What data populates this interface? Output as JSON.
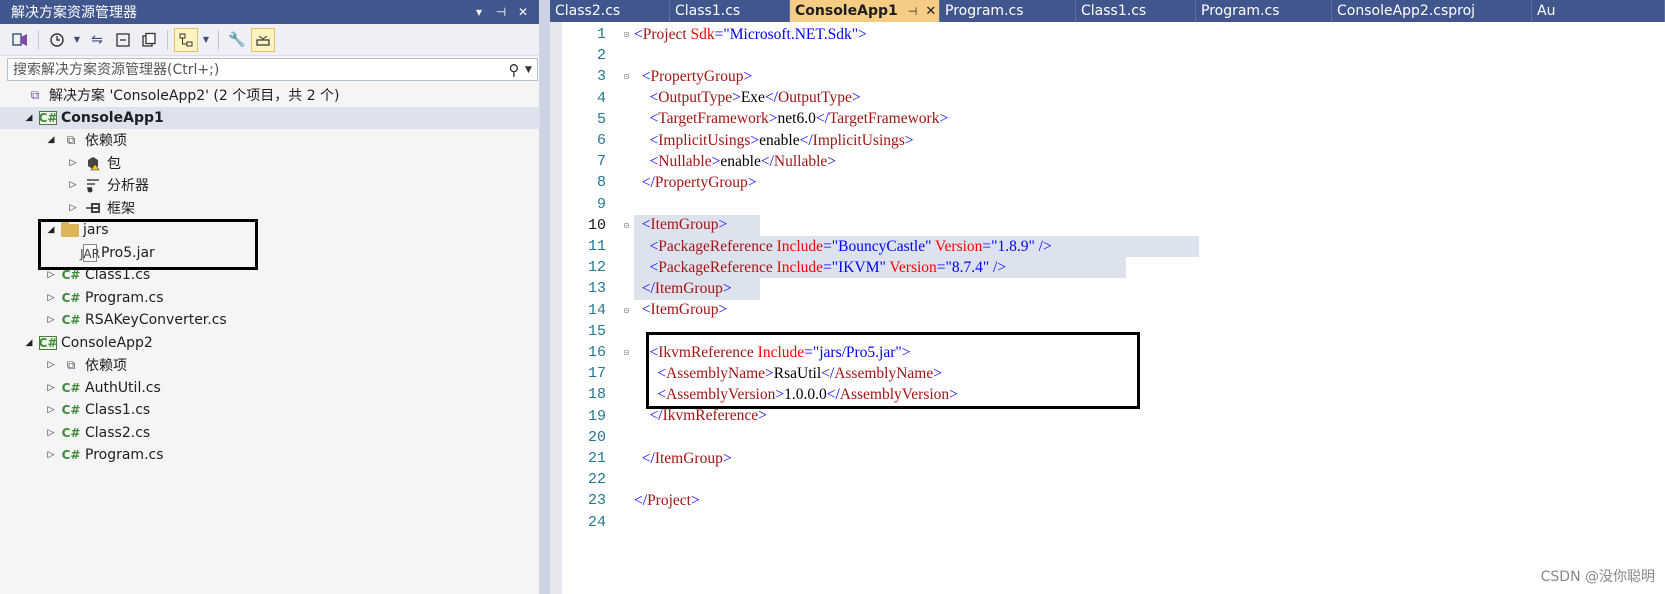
{
  "explorer": {
    "title": "解决方案资源管理器",
    "title_buttons": [
      "▾",
      "⊣",
      "✕"
    ],
    "search_placeholder": "搜索解决方案资源管理器(Ctrl+;)",
    "tree": [
      {
        "label": "解决方案 'ConsoleApp2' (2 个项目，共 2 个)",
        "icon": "solution-icon",
        "depth": 0,
        "arrow": "",
        "bold": false
      },
      {
        "label": "ConsoleApp1",
        "icon": "csharp-project-icon",
        "depth": 0,
        "arrow": "expanded",
        "bold": true,
        "selected": true
      },
      {
        "label": "依赖项",
        "icon": "dependencies-icon",
        "depth": 1,
        "arrow": "expanded",
        "bold": false
      },
      {
        "label": "包",
        "icon": "package-warning-icon",
        "depth": 2,
        "arrow": "collapsed",
        "bold": false
      },
      {
        "label": "分析器",
        "icon": "analyzer-icon",
        "depth": 2,
        "arrow": "collapsed",
        "bold": false
      },
      {
        "label": "框架",
        "icon": "framework-icon",
        "depth": 2,
        "arrow": "collapsed",
        "bold": false
      },
      {
        "label": "jars",
        "icon": "folder-icon",
        "depth": 1,
        "arrow": "expanded",
        "bold": false
      },
      {
        "label": "Pro5.jar",
        "icon": "jar-file-icon",
        "depth": 2,
        "arrow": "",
        "bold": false
      },
      {
        "label": "Class1.cs",
        "icon": "csharp-file-icon",
        "depth": 1,
        "arrow": "collapsed",
        "bold": false
      },
      {
        "label": "Program.cs",
        "icon": "csharp-file-icon",
        "depth": 1,
        "arrow": "collapsed",
        "bold": false
      },
      {
        "label": "RSAKeyConverter.cs",
        "icon": "csharp-file-icon",
        "depth": 1,
        "arrow": "collapsed",
        "bold": false
      },
      {
        "label": "ConsoleApp2",
        "icon": "csharp-project-icon",
        "depth": 0,
        "arrow": "expanded",
        "bold": false
      },
      {
        "label": "依赖项",
        "icon": "dependencies-icon",
        "depth": 1,
        "arrow": "collapsed",
        "bold": false
      },
      {
        "label": "AuthUtil.cs",
        "icon": "csharp-file-icon",
        "depth": 1,
        "arrow": "collapsed",
        "bold": false
      },
      {
        "label": "Class1.cs",
        "icon": "csharp-file-icon",
        "depth": 1,
        "arrow": "collapsed",
        "bold": false
      },
      {
        "label": "Class2.cs",
        "icon": "csharp-file-icon",
        "depth": 1,
        "arrow": "collapsed",
        "bold": false
      },
      {
        "label": "Program.cs",
        "icon": "csharp-file-icon",
        "depth": 1,
        "arrow": "collapsed",
        "bold": false
      }
    ]
  },
  "tabs": [
    {
      "label": "Class2.cs",
      "active": false
    },
    {
      "label": "Class1.cs",
      "active": false
    },
    {
      "label": "ConsoleApp1",
      "active": true
    },
    {
      "label": "Program.cs",
      "active": false
    },
    {
      "label": "Class1.cs",
      "active": false
    },
    {
      "label": "Program.cs",
      "active": false
    },
    {
      "label": "ConsoleApp2.csproj",
      "active": false
    },
    {
      "label": "Au",
      "active": false
    }
  ],
  "editor": {
    "current_line": 10,
    "lines": [
      {
        "n": "1",
        "fold": "⊟",
        "tokens": [
          [
            "br",
            "<"
          ],
          [
            "tag",
            "Project"
          ],
          [
            "plain",
            " "
          ],
          [
            "attr",
            "Sdk"
          ],
          [
            "br",
            "=\""
          ],
          [
            "val",
            "Microsoft.NET.Sdk"
          ],
          [
            "br",
            "\">"
          ]
        ]
      },
      {
        "n": "2",
        "fold": "",
        "tokens": []
      },
      {
        "n": "3",
        "fold": "⊟",
        "tokens": [
          [
            "plain",
            "  "
          ],
          [
            "br",
            "<"
          ],
          [
            "tag",
            "PropertyGroup"
          ],
          [
            "br",
            ">"
          ]
        ]
      },
      {
        "n": "4",
        "fold": "",
        "tokens": [
          [
            "plain",
            "    "
          ],
          [
            "br",
            "<"
          ],
          [
            "tag",
            "OutputType"
          ],
          [
            "br",
            ">"
          ],
          [
            "plain",
            "Exe"
          ],
          [
            "br",
            "</"
          ],
          [
            "tag",
            "OutputType"
          ],
          [
            "br",
            ">"
          ]
        ]
      },
      {
        "n": "5",
        "fold": "",
        "tokens": [
          [
            "plain",
            "    "
          ],
          [
            "br",
            "<"
          ],
          [
            "tag",
            "TargetFramework"
          ],
          [
            "br",
            ">"
          ],
          [
            "plain",
            "net6.0"
          ],
          [
            "br",
            "</"
          ],
          [
            "tag",
            "TargetFramework"
          ],
          [
            "br",
            ">"
          ]
        ]
      },
      {
        "n": "6",
        "fold": "",
        "tokens": [
          [
            "plain",
            "    "
          ],
          [
            "br",
            "<"
          ],
          [
            "tag",
            "ImplicitUsings"
          ],
          [
            "br",
            ">"
          ],
          [
            "plain",
            "enable"
          ],
          [
            "br",
            "</"
          ],
          [
            "tag",
            "ImplicitUsings"
          ],
          [
            "br",
            ">"
          ]
        ]
      },
      {
        "n": "7",
        "fold": "",
        "tokens": [
          [
            "plain",
            "    "
          ],
          [
            "br",
            "<"
          ],
          [
            "tag",
            "Nullable"
          ],
          [
            "br",
            ">"
          ],
          [
            "plain",
            "enable"
          ],
          [
            "br",
            "</"
          ],
          [
            "tag",
            "Nullable"
          ],
          [
            "br",
            ">"
          ]
        ]
      },
      {
        "n": "8",
        "fold": "",
        "tokens": [
          [
            "plain",
            "  "
          ],
          [
            "br",
            "</"
          ],
          [
            "tag",
            "PropertyGroup"
          ],
          [
            "br",
            ">"
          ]
        ]
      },
      {
        "n": "9",
        "fold": "",
        "tokens": []
      },
      {
        "n": "10",
        "fold": "⊟",
        "tokens": [
          [
            "plain",
            "  "
          ],
          [
            "br",
            "<"
          ],
          [
            "tag",
            "ItemGroup"
          ],
          [
            "br",
            ">"
          ]
        ]
      },
      {
        "n": "11",
        "fold": "",
        "tokens": [
          [
            "plain",
            "    "
          ],
          [
            "br",
            "<"
          ],
          [
            "tag",
            "PackageReference"
          ],
          [
            "plain",
            " "
          ],
          [
            "attr",
            "Include"
          ],
          [
            "br",
            "=\""
          ],
          [
            "val",
            "BouncyCastle"
          ],
          [
            "br",
            "\""
          ],
          [
            "plain",
            " "
          ],
          [
            "attr",
            "Version"
          ],
          [
            "br",
            "=\""
          ],
          [
            "val",
            "1.8.9"
          ],
          [
            "br",
            "\" />"
          ]
        ]
      },
      {
        "n": "12",
        "fold": "",
        "tokens": [
          [
            "plain",
            "    "
          ],
          [
            "br",
            "<"
          ],
          [
            "tag",
            "PackageReference"
          ],
          [
            "plain",
            " "
          ],
          [
            "attr",
            "Include"
          ],
          [
            "br",
            "=\""
          ],
          [
            "val",
            "IKVM"
          ],
          [
            "br",
            "\""
          ],
          [
            "plain",
            " "
          ],
          [
            "attr",
            "Version"
          ],
          [
            "br",
            "=\""
          ],
          [
            "val",
            "8.7.4"
          ],
          [
            "br",
            "\" />"
          ]
        ]
      },
      {
        "n": "13",
        "fold": "",
        "tokens": [
          [
            "plain",
            "  "
          ],
          [
            "br",
            "</"
          ],
          [
            "tag",
            "ItemGroup"
          ],
          [
            "br",
            ">"
          ]
        ]
      },
      {
        "n": "14",
        "fold": "⊟",
        "tokens": [
          [
            "plain",
            "  "
          ],
          [
            "br",
            "<"
          ],
          [
            "tag",
            "ItemGroup"
          ],
          [
            "br",
            ">"
          ]
        ]
      },
      {
        "n": "15",
        "fold": "",
        "tokens": []
      },
      {
        "n": "16",
        "fold": "⊟",
        "tokens": [
          [
            "plain",
            "    "
          ],
          [
            "br",
            "<"
          ],
          [
            "tag",
            "IkvmReference"
          ],
          [
            "plain",
            " "
          ],
          [
            "attr",
            "Include"
          ],
          [
            "br",
            "=\""
          ],
          [
            "val",
            "jars/Pro5.jar"
          ],
          [
            "br",
            "\">"
          ]
        ]
      },
      {
        "n": "17",
        "fold": "",
        "tokens": [
          [
            "plain",
            "      "
          ],
          [
            "br",
            "<"
          ],
          [
            "tag",
            "AssemblyName"
          ],
          [
            "br",
            ">"
          ],
          [
            "plain",
            "RsaUtil"
          ],
          [
            "br",
            "</"
          ],
          [
            "tag",
            "AssemblyName"
          ],
          [
            "br",
            ">"
          ]
        ]
      },
      {
        "n": "18",
        "fold": "",
        "tokens": [
          [
            "plain",
            "      "
          ],
          [
            "br",
            "<"
          ],
          [
            "tag",
            "AssemblyVersion"
          ],
          [
            "br",
            ">"
          ],
          [
            "plain",
            "1.0.0.0"
          ],
          [
            "br",
            "</"
          ],
          [
            "tag",
            "AssemblyVersion"
          ],
          [
            "br",
            ">"
          ]
        ]
      },
      {
        "n": "19",
        "fold": "",
        "tokens": [
          [
            "plain",
            "    "
          ],
          [
            "br",
            "</"
          ],
          [
            "tag",
            "IkvmReference"
          ],
          [
            "br",
            ">"
          ]
        ]
      },
      {
        "n": "20",
        "fold": "",
        "tokens": []
      },
      {
        "n": "21",
        "fold": "",
        "tokens": [
          [
            "plain",
            "  "
          ],
          [
            "br",
            "</"
          ],
          [
            "tag",
            "ItemGroup"
          ],
          [
            "br",
            ">"
          ]
        ]
      },
      {
        "n": "22",
        "fold": "",
        "tokens": []
      },
      {
        "n": "23",
        "fold": "",
        "tokens": [
          [
            "br",
            "</"
          ],
          [
            "tag",
            "Project"
          ],
          [
            "br",
            ">"
          ]
        ]
      },
      {
        "n": "24",
        "fold": "",
        "tokens": []
      }
    ]
  },
  "watermark": "CSDN @没你聪明"
}
